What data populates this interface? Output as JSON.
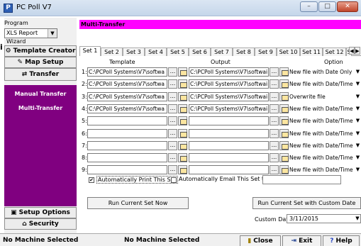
{
  "window": {
    "title": "PC Poll V7"
  },
  "left_panel": {
    "program_label": "Program",
    "program_value": "XLS Report Wizard",
    "nav": [
      {
        "label": "Template Creator"
      },
      {
        "label": "Map Setup"
      },
      {
        "label": "Transfer"
      }
    ],
    "sub_items": [
      {
        "label": "Manual Transfer"
      },
      {
        "label": "Multi-Transfer"
      }
    ],
    "bottom_nav": [
      {
        "label": "Setup Options"
      },
      {
        "label": "Security"
      }
    ]
  },
  "edge_label": "i",
  "panel_title": "Multi-Transfer",
  "tabs": [
    "Set 1",
    "Set 2",
    "Set 3",
    "Set 4",
    "Set 5",
    "Set 6",
    "Set 7",
    "Set 8",
    "Set 9",
    "Set 10",
    "Set 11",
    "Set 12",
    "S"
  ],
  "columns": {
    "template": "Template",
    "output": "Output",
    "option": "Option"
  },
  "rows": [
    {
      "num": "1:",
      "template": "C:\\PCPoll Systems\\V7\\softwa",
      "output": "C:\\PCPoll Systems\\V7\\softwai",
      "option": "New file with Date Only"
    },
    {
      "num": "2:",
      "template": "C:\\PCPoll Systems\\V7\\softwa",
      "output": "C:\\PCPoll Systems\\V7\\softwai",
      "option": "New file with Date/Time"
    },
    {
      "num": "3:",
      "template": "C:\\PCPoll Systems\\V7\\softwa",
      "output": "C:\\PCPoll Systems\\V7\\softwai",
      "option": "Overwrite file"
    },
    {
      "num": "4:",
      "template": "C:\\PCPoll Systems\\V7\\softwa",
      "output": "C:\\PCPoll Systems\\V7\\softwai",
      "option": "New file with Date/Time"
    },
    {
      "num": "5:",
      "template": "",
      "output": "",
      "option": "New file with Date/Time"
    },
    {
      "num": "6:",
      "template": "",
      "output": "",
      "option": "New file with Date/Time"
    },
    {
      "num": "7:",
      "template": "",
      "output": "",
      "option": "New file with Date/Time"
    },
    {
      "num": "8:",
      "template": "",
      "output": "",
      "option": "New file with Date/Time"
    },
    {
      "num": "9:",
      "template": "",
      "output": "",
      "option": "New file with Date/Time"
    }
  ],
  "auto_print": {
    "label": "Automatically Print This Set",
    "checked": "✔"
  },
  "auto_email": {
    "label": "Automatically Email This Set to",
    "checked": ""
  },
  "buttons": {
    "run_now": "Run Current Set Now",
    "run_custom": "Run Current Set with Custom Date"
  },
  "custom_date": {
    "label": "Custom Date",
    "value": "3/11/2015"
  },
  "status": {
    "left": "No Machine Selected",
    "middle": "No Machine Selected"
  },
  "footer_buttons": {
    "close": "Close",
    "exit": "Exit",
    "help": "Help"
  }
}
